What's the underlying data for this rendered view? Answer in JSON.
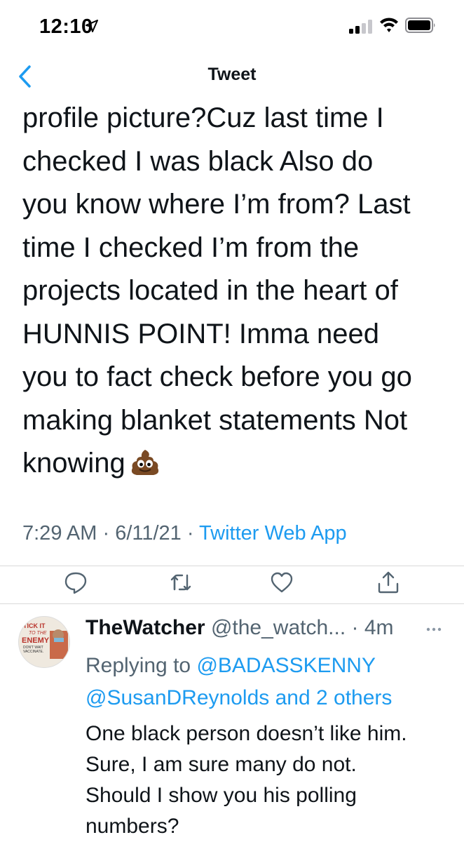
{
  "status_bar": {
    "time": "12:10",
    "icons": [
      "location-arrow-icon",
      "signal-icon",
      "wifi-icon",
      "battery-icon"
    ]
  },
  "nav": {
    "title": "Tweet",
    "back_icon": "chevron-left-icon"
  },
  "tweet": {
    "text": "profile picture?Cuz last time I\nchecked I was black  Also do\nyou know where I’m from? Last\ntime I checked I’m from the\nprojects located in the heart  of\nHUNNIS  POINT! Imma need\nyou to fact check before you go\nmaking blanket statements  Not\nknowing",
    "emoji": "pile-of-poo",
    "time": "7:29 AM",
    "date": "6/11/21",
    "separator": " · ",
    "source": "Twitter Web App"
  },
  "actions": [
    "reply-icon",
    "retweet-icon",
    "like-icon",
    "share-icon"
  ],
  "reply": {
    "name": "TheWatcher",
    "handle": "@the_watch...",
    "age": "4m",
    "replying_prefix": "Replying to ",
    "mention1": "@BADASSKENNY",
    "mention2": "@SusanDReynolds",
    "and": " and ",
    "others": "2 others",
    "text": "One black person doesn’t like him.\nSure, I am sure many do not.\nShould I show you his polling\nnumbers?",
    "avatar_text": {
      "line1": "TICK IT",
      "line2": "TO THE",
      "line3": "ENEMY",
      "line4": "DON'T WAIT",
      "line5": "VACCINATE."
    }
  },
  "colors": {
    "accent": "#1d9bf0",
    "text": "#0f1419",
    "muted": "#536471",
    "divider": "#d9d9d9"
  }
}
